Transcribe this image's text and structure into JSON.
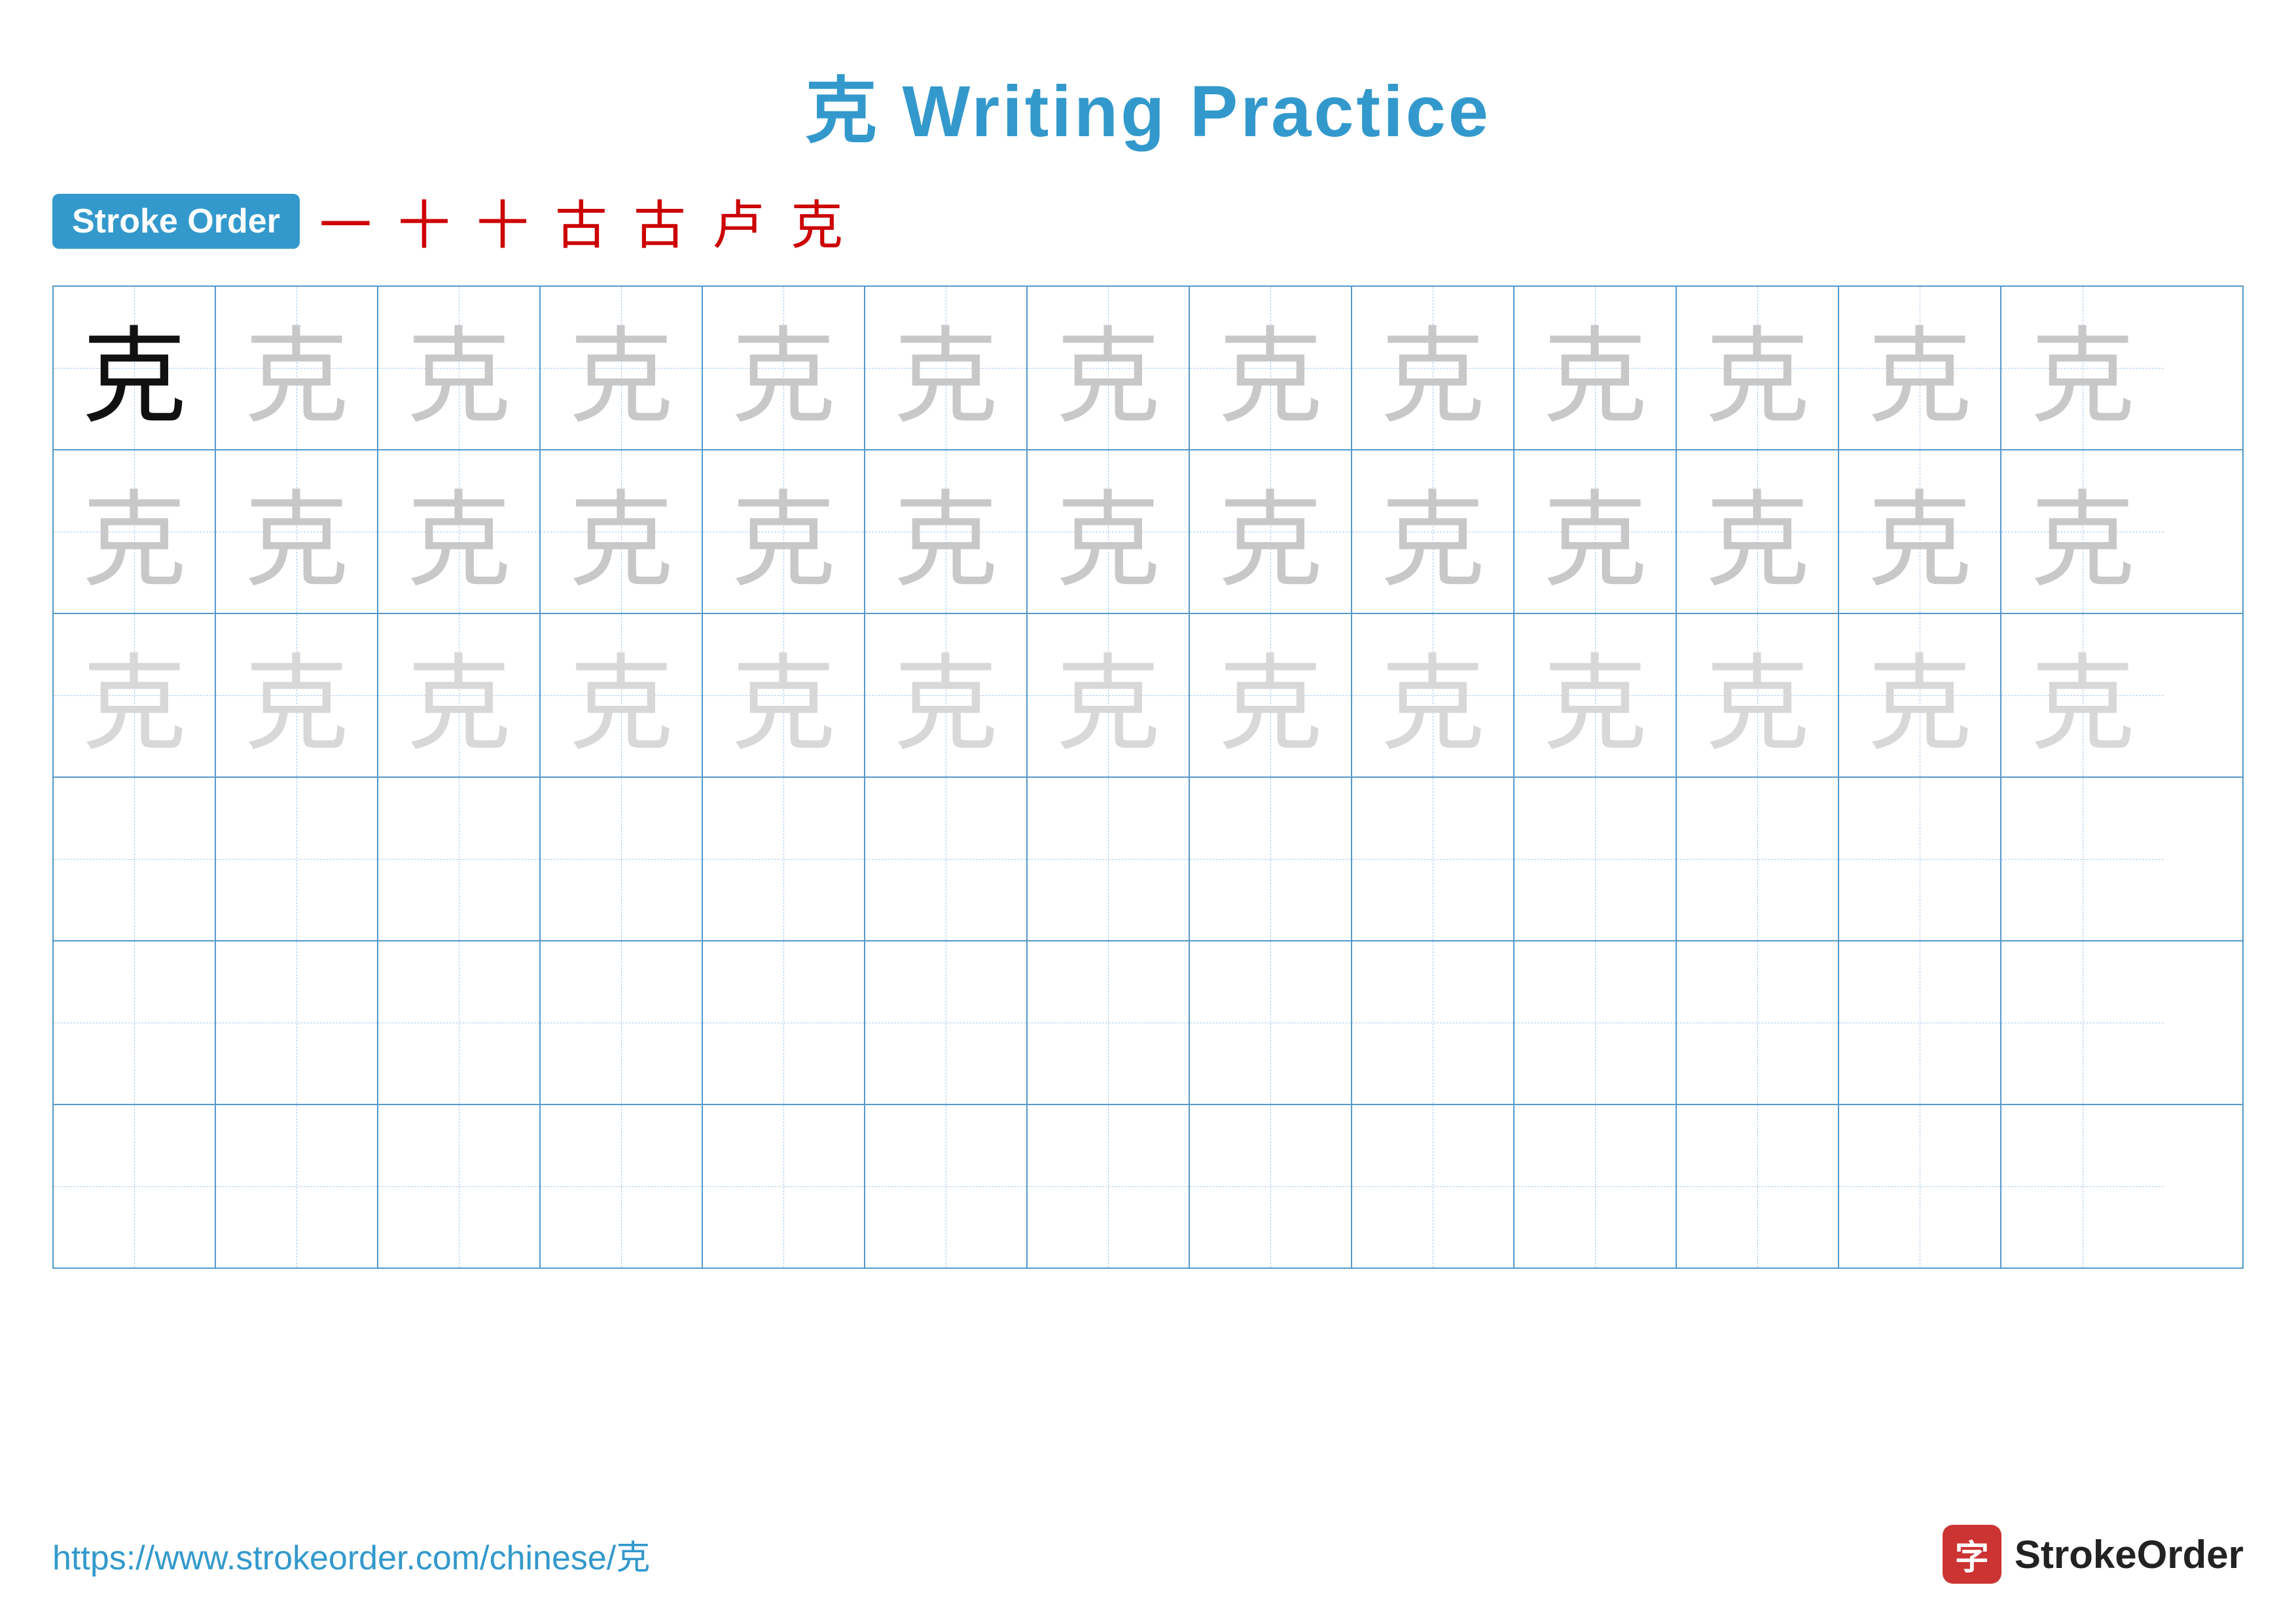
{
  "page": {
    "title": "克 Writing Practice",
    "title_char": "克",
    "title_text": " Writing Practice"
  },
  "stroke_order": {
    "badge_label": "Stroke Order",
    "strokes": [
      "一",
      "十",
      "十",
      "古",
      "古",
      "卢",
      "克"
    ]
  },
  "grid": {
    "rows": 6,
    "cols": 13,
    "char": "克",
    "row_types": [
      "dark_first",
      "gray_dark",
      "gray_medium",
      "empty",
      "empty",
      "empty"
    ]
  },
  "footer": {
    "url": "https://www.strokeorder.com/chinese/克",
    "logo_text": "StrokeOrder",
    "logo_char": "字"
  }
}
